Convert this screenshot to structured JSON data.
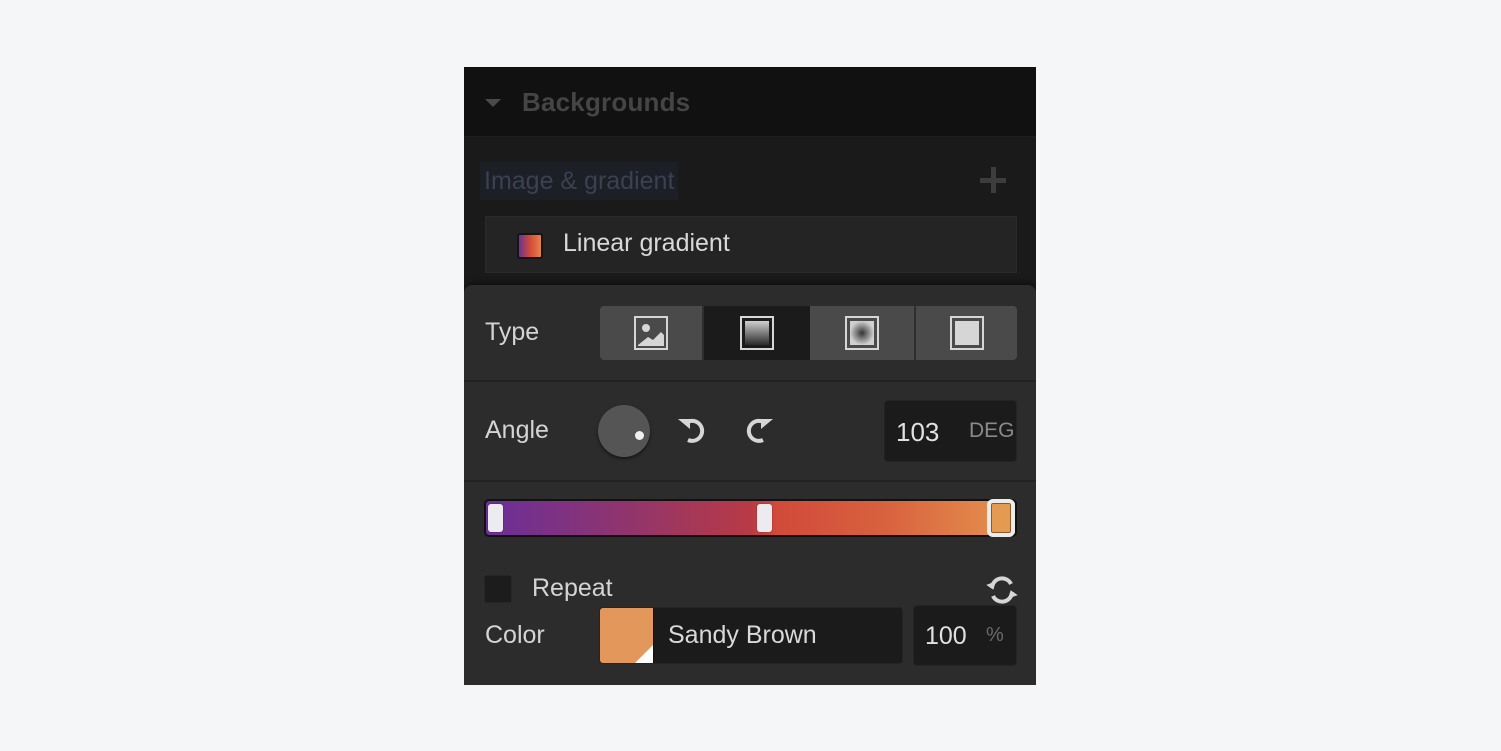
{
  "section": {
    "title": "Backgrounds",
    "expanded": true
  },
  "layers": {
    "label": "Image & gradient",
    "add_icon": "plus-icon",
    "items": [
      {
        "label": "Linear gradient",
        "swatch_colors": [
          "#6b3394",
          "#d24a3a",
          "#e8824a"
        ]
      }
    ]
  },
  "editor": {
    "type": {
      "label": "Type",
      "options": [
        {
          "name": "image",
          "icon": "image-icon",
          "active": false
        },
        {
          "name": "linear-gradient",
          "icon": "linear-gradient-icon",
          "active": true
        },
        {
          "name": "radial-gradient",
          "icon": "radial-gradient-icon",
          "active": false
        },
        {
          "name": "color-overlay",
          "icon": "solid-color-icon",
          "active": false
        }
      ]
    },
    "angle": {
      "label": "Angle",
      "value": "103",
      "unit": "DEG",
      "rotate_left_icon": "rotate-counterclockwise-icon",
      "rotate_right_icon": "rotate-clockwise-icon"
    },
    "gradient": {
      "stops": [
        {
          "position_pct": 1,
          "color": "#ececf0",
          "selected": false
        },
        {
          "position_pct": 55,
          "color": "#ececf0",
          "selected": false
        },
        {
          "position_pct": 100,
          "color": "#e59a52",
          "selected": true
        }
      ],
      "colors": [
        "#6a2f98",
        "#d14a3a",
        "#e5934f"
      ]
    },
    "repeat": {
      "label": "Repeat",
      "checked": false,
      "reverse_icon": "reverse-sync-icon"
    },
    "color": {
      "label": "Color",
      "name": "Sandy Brown",
      "hex": "#e4975a",
      "opacity": "100",
      "opacity_unit": "%"
    }
  }
}
